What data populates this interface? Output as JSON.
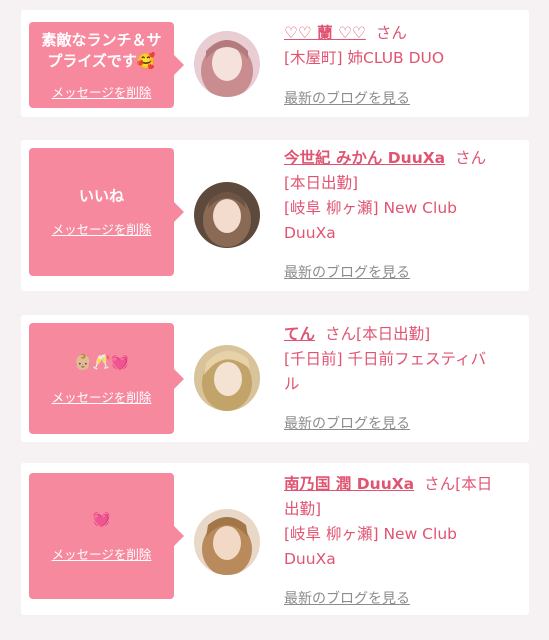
{
  "colors": {
    "accent": "#e05472",
    "bubble": "#f7899f",
    "muted": "#8c8c8c",
    "background": "#f6f2f4"
  },
  "delete_label": "メッセージを削除",
  "blog_label": "最新のブログを見る",
  "cards": [
    {
      "message": "素敵なランチ＆サ\nプライズです🥰",
      "name": "♡♡ 蘭 ♡♡",
      "san": "さん",
      "line1": "[木屋町] 姉CLUB DUO"
    },
    {
      "message": "いいね",
      "name": "今世紀 みかん DuuXa",
      "san": "さん",
      "line1": "[本日出勤]",
      "line2": "[岐阜 柳ヶ瀬] New Club",
      "line3": "DuuXa"
    },
    {
      "message": "👶🏼🥂💓",
      "name": "てん",
      "san": "さん[本日出勤]",
      "line1": "[千日前] 千日前フェスティバ",
      "line2": "ル"
    },
    {
      "message": "💓",
      "name": "南乃国 潤 DuuXa",
      "san": "さん[本日",
      "line1": "出勤]",
      "line2": "[岐阜 柳ヶ瀬] New Club",
      "line3": "DuuXa"
    }
  ]
}
